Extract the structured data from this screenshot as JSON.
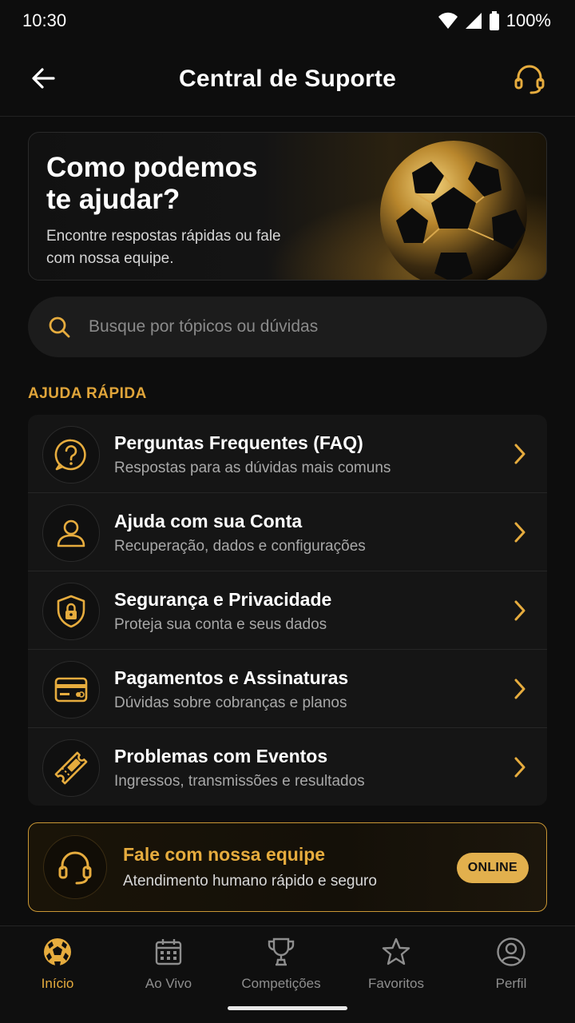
{
  "status_bar": {
    "time": "10:30",
    "battery": "100%"
  },
  "header": {
    "title": "Central de Suporte",
    "back_icon": "arrow-left-icon",
    "support_icon": "headset-icon"
  },
  "hero": {
    "title": "Como podemos te ajudar?",
    "subtitle": "Encontre respostas rápidas ou fale com nossa equipe."
  },
  "search": {
    "placeholder": "Busque por tópicos ou dúvidas",
    "value": ""
  },
  "quick_help": {
    "section_title": "AJUDA RÁPIDA",
    "items": [
      {
        "title": "Perguntas Frequentes (FAQ)",
        "subtitle": "Respostas para as dúvidas mais comuns",
        "icon": "question-bubble-icon"
      },
      {
        "title": "Ajuda com sua Conta",
        "subtitle": "Recuperação, dados e configurações",
        "icon": "user-icon"
      },
      {
        "title": "Segurança e Privacidade",
        "subtitle": "Proteja sua conta e seus dados",
        "icon": "shield-lock-icon"
      },
      {
        "title": "Pagamentos e Assinaturas",
        "subtitle": "Dúvidas sobre cobranças e planos",
        "icon": "credit-card-icon"
      },
      {
        "title": "Problemas com Eventos",
        "subtitle": "Ingressos, transmissões e resultados",
        "icon": "ticket-icon"
      }
    ]
  },
  "contact": {
    "title": "Fale com nossa equipe",
    "subtitle": "Atendimento humano rápido e seguro",
    "badge": "ONLINE",
    "icon": "headset-icon"
  },
  "bottom_nav": {
    "items": [
      {
        "label": "Início",
        "icon": "soccer-ball-icon",
        "active": true
      },
      {
        "label": "Ao Vivo",
        "icon": "calendar-icon",
        "active": false
      },
      {
        "label": "Competições",
        "icon": "trophy-icon",
        "active": false
      },
      {
        "label": "Favoritos",
        "icon": "star-icon",
        "active": false
      },
      {
        "label": "Perfil",
        "icon": "profile-icon",
        "active": false
      }
    ]
  },
  "colors": {
    "accent": "#e6ac3e",
    "background": "#0d0d0d",
    "card": "#151515"
  }
}
